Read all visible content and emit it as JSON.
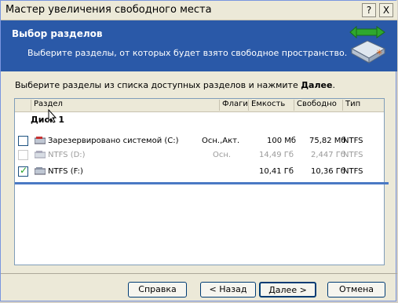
{
  "window": {
    "title": "Мастер увеличения свободного места",
    "help_btn": "?",
    "close_btn": "X"
  },
  "banner": {
    "title": "Выбор разделов",
    "subtitle": "Выберите разделы, от которых будет взято свободное пространство.",
    "icon": "disk-space-arrows-icon"
  },
  "instruction": {
    "text": "Выберите разделы из списка доступных разделов и нажмите ",
    "bold": "Далее",
    "end": "."
  },
  "table": {
    "columns": [
      "Раздел",
      "Флаги",
      "Емкость",
      "Свободно",
      "Тип"
    ],
    "group": "Диск 1",
    "rows": [
      {
        "name": "Зарезервировано системой (C:)",
        "flags": "Осн.,Акт.",
        "capacity": "100 Мб",
        "free": "75,82 Мб",
        "type": "NTFS",
        "checked": false,
        "enabled": true
      },
      {
        "name": "NTFS (D:)",
        "flags": "Осн.",
        "capacity": "14,49 Гб",
        "free": "2,447 Гб",
        "type": "NTFS",
        "checked": false,
        "enabled": false
      },
      {
        "name": "NTFS (F:)",
        "flags": "",
        "capacity": "10,41 Гб",
        "free": "10,36 Гб",
        "type": "NTFS",
        "checked": true,
        "enabled": true
      }
    ]
  },
  "buttons": {
    "help": "Справка",
    "back": "< Назад",
    "next": "Далее >",
    "cancel": "Отмена"
  }
}
